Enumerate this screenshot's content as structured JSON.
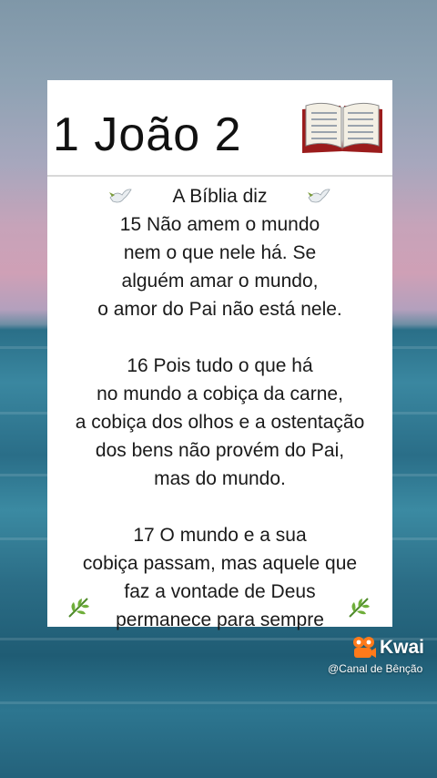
{
  "card": {
    "title": "1 João 2",
    "lines": [
      "A Bíblia diz",
      "15 Não amem o mundo",
      "nem o que nele há. Se",
      "alguém amar o mundo,",
      "o amor do Pai não está nele.",
      "",
      "16 Pois tudo o que há",
      "no mundo a cobiça da carne,",
      "a cobiça dos olhos e a ostentação",
      "dos bens não provém do Pai,",
      "mas do mundo.",
      "",
      "17 O mundo e a sua",
      "cobiça passam, mas aquele que",
      "faz a vontade de Deus",
      "permanece para sempre"
    ]
  },
  "icons": {
    "title_icon": "open-book-icon",
    "left_header_icon": "dove-icon",
    "right_header_icon": "dove-icon",
    "footer_left_icon": "herb-leaf-icon",
    "footer_right_icon": "herb-leaf-icon"
  },
  "watermark": {
    "brand": "Kwai",
    "handle": "@Canal de Bênção"
  },
  "colors": {
    "card_bg": "#ffffff",
    "text": "#1a1a1a",
    "brand_orange": "#ff7a1a",
    "sea": "#2a6f88"
  }
}
